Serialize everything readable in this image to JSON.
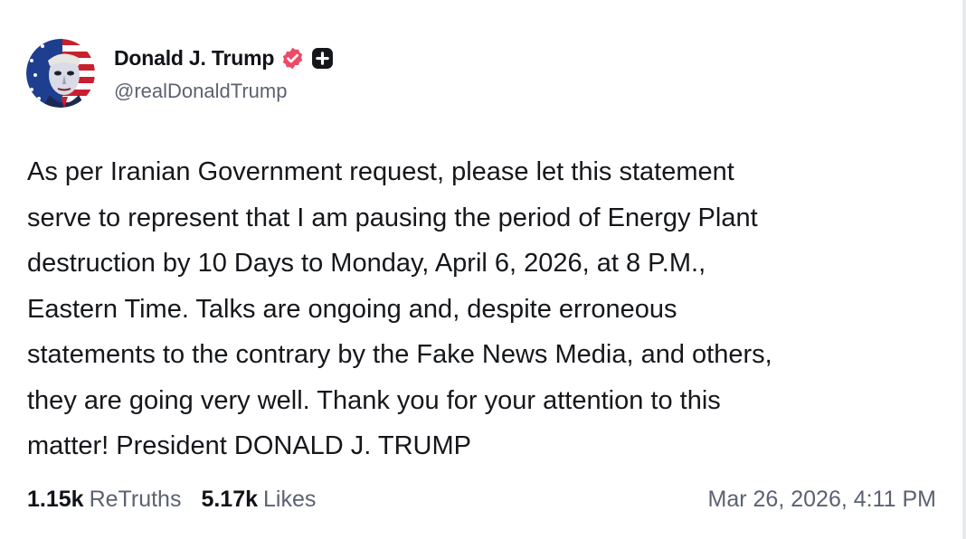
{
  "author": {
    "display_name": "Donald J. Trump",
    "handle": "@realDonaldTrump",
    "verified_badge_icon": "verified-check-icon",
    "verified_badge_color": "#ee4a66",
    "plus_badge_icon": "plus-square-icon"
  },
  "post": {
    "text": "As per Iranian Government request, please let this statement\nserve to represent that I am pausing the period of Energy Plant\ndestruction by 10 Days to Monday, April 6, 2026, at 8 P.M.,\nEastern Time. Talks are ongoing and, despite erroneous\nstatements to the contrary by the Fake News Media, and others,\nthey are going very well. Thank you for your attention to this\nmatter! President DONALD J. TRUMP"
  },
  "stats": {
    "retruths_count": "1.15k",
    "retruths_label": "ReTruths",
    "likes_count": "5.17k",
    "likes_label": "Likes"
  },
  "timestamp": "Mar 26, 2026, 4:11 PM"
}
